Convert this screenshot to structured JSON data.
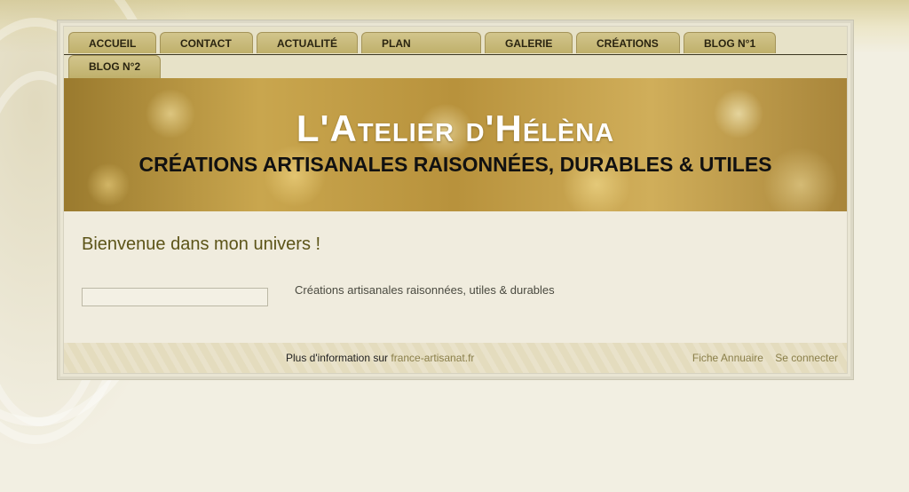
{
  "nav": {
    "tabs": [
      {
        "label": "ACCUEIL"
      },
      {
        "label": "CONTACT"
      },
      {
        "label": "ACTUALITÉ"
      },
      {
        "label": "PLAN"
      },
      {
        "label": "GALERIE"
      },
      {
        "label": "CRÉATIONS"
      },
      {
        "label": "BLOG N°1"
      },
      {
        "label": "BLOG N°2"
      }
    ]
  },
  "banner": {
    "title": "L'Atelier d'Hélèna",
    "subtitle": "CRÉATIONS ARTISANALES RAISONNÉES, DURABLES & UTILES"
  },
  "main": {
    "welcome": "Bienvenue dans mon univers !",
    "search_value": "",
    "intro": "Créations artisanales raisonnées, utiles & durables"
  },
  "footer": {
    "info_prefix": "Plus d'information sur",
    "info_link": "france-artisanat.fr",
    "directory_link": "Fiche Annuaire",
    "login_link": "Se connecter"
  },
  "colors": {
    "tab": "#c8b97a",
    "welcome": "#5c5418",
    "banner_gold": "#c9a64e"
  }
}
